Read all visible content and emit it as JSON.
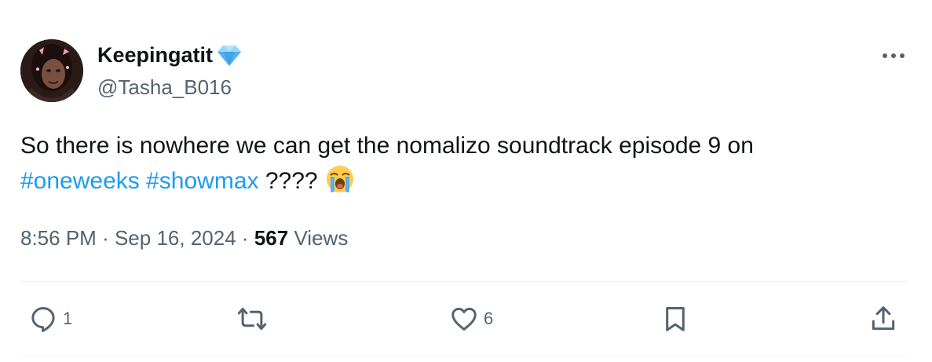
{
  "author": {
    "display_name": "Keepingatit",
    "handle": "@Tasha_B016",
    "badge_icon": "diamond-icon",
    "avatar_icon": "profile-photo"
  },
  "tweet": {
    "text_line1": "So there is nowhere we can get the nomalizo soundtrack episode 9 on",
    "hashtags": [
      "#oneweeks",
      "#showmax"
    ],
    "trailing_text": "????",
    "emoji": "loudly-crying-face-icon"
  },
  "meta": {
    "time": "8:56 PM",
    "separator": "·",
    "date": "Sep 16, 2024",
    "views_count": "567",
    "views_label": "Views"
  },
  "actions": {
    "reply_count": "1",
    "retweet_count": "",
    "like_count": "6"
  },
  "colors": {
    "accent": "#1d9bf0",
    "text": "#0f1419",
    "secondary": "#536471",
    "divider": "#eff3f4"
  }
}
